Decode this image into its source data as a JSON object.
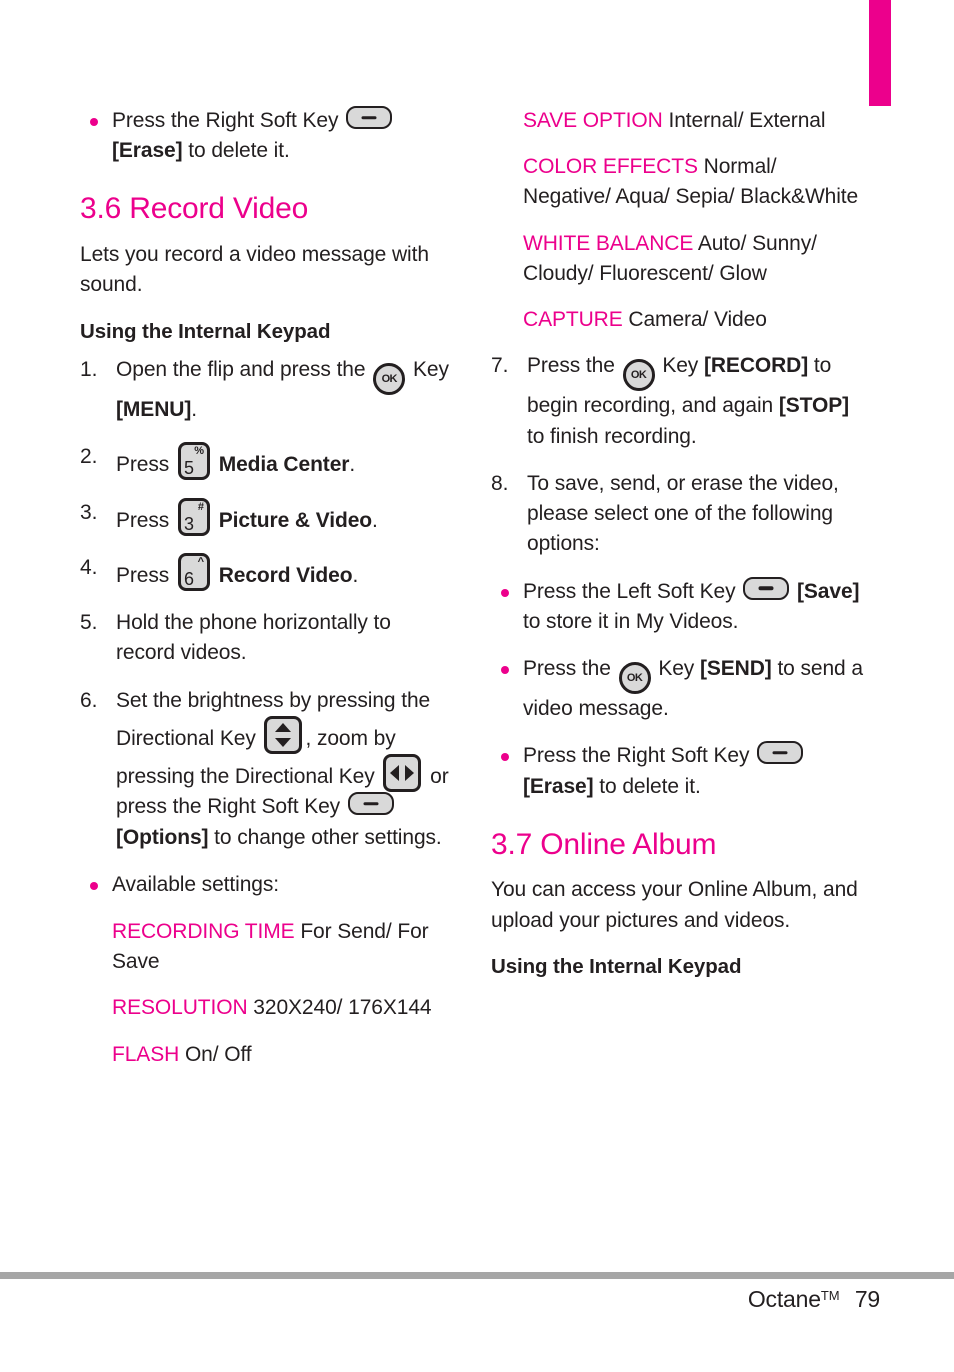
{
  "colors": {
    "accent": "#ec008c",
    "text": "#231f20",
    "key_fill": "#d9d9d9",
    "rule": "#a6a6a6"
  },
  "chapter_tab": {
    "label": ""
  },
  "left_column": {
    "top_bullet": {
      "lead": "Press the Right Soft Key",
      "icon": "soft-key-icon",
      "bold": "[Erase]",
      "tail": "to delete it."
    },
    "heading": "3.6 Record Video",
    "intro": "Lets you record a video message with sound.",
    "subheading": "Using the Internal Keypad",
    "steps": [
      {
        "num": "1.",
        "lead": "Open the flip and press the",
        "icon": "ok-key-icon",
        "mid": "Key",
        "bold": "[MENU]",
        "tail": "."
      },
      {
        "num": "2.",
        "lead": "Press",
        "icon": "num-key-5-icon",
        "key_digit": "5",
        "key_sup": "%",
        "bold": "Media Center",
        "tail": "."
      },
      {
        "num": "3.",
        "lead": "Press",
        "icon": "num-key-3-icon",
        "key_digit": "3",
        "key_sup": "#",
        "bold": "Picture & Video",
        "tail": "."
      },
      {
        "num": "4.",
        "lead": "Press",
        "icon": "num-key-6-icon",
        "key_digit": "6",
        "key_sup": "^",
        "bold": "Record Video",
        "tail": "."
      },
      {
        "num": "5.",
        "lead": "Hold the phone horizontally to record videos."
      },
      {
        "num": "6.",
        "part1": "Set the brightness by pressing the Directional Key",
        "icon1": "directional-key-vertical-icon",
        "part2": ", zoom by pressing the Directional Key",
        "icon2": "directional-key-horizontal-icon",
        "part3": "or press the Right Soft",
        "part4": "Key",
        "icon3": "soft-key-icon",
        "bold": "[Options]",
        "part5": "to change other settings."
      }
    ],
    "available_bullet": "Available settings:",
    "settings": [
      {
        "term": "RECORDING TIME",
        "value": "For Send/ For Save"
      },
      {
        "term": "RESOLUTION",
        "value": "320X240/ 176X144"
      },
      {
        "term": "FLASH",
        "value": "On/ Off"
      }
    ]
  },
  "right_column": {
    "settings": [
      {
        "term": "SAVE OPTION",
        "value": "Internal/ External"
      },
      {
        "term": "COLOR EFFECTS",
        "value": "Normal/ Negative/ Aqua/ Sepia/ Black&White"
      },
      {
        "term": "WHITE BALANCE",
        "value": "Auto/ Sunny/ Cloudy/ Fluorescent/ Glow"
      },
      {
        "term": "CAPTURE",
        "value": "Camera/ Video"
      }
    ],
    "steps": [
      {
        "num": "7.",
        "lead": "Press the",
        "icon": "ok-key-icon",
        "mid": "Key",
        "bold1": "[RECORD]",
        "mid2": "to begin recording, and again",
        "bold2": "[STOP]",
        "tail": "to finish recording."
      },
      {
        "num": "8.",
        "lead": "To save, send, or erase the video, please select one of the following options:"
      }
    ],
    "bullets": [
      {
        "lead": "Press the Left Soft Key",
        "icon": "soft-key-icon",
        "bold": "[Save]",
        "tail": "to store it in My Videos."
      },
      {
        "lead": "Press the",
        "icon": "ok-key-icon",
        "mid": "Key",
        "bold": "[SEND]",
        "tail": "to send a video message."
      },
      {
        "lead": "Press the Right Soft Key",
        "icon": "soft-key-icon",
        "bold": "[Erase]",
        "tail": "to delete it."
      }
    ],
    "heading": "3.7 Online Album",
    "intro": "You can access your Online Album, and upload your pictures and videos.",
    "subheading": "Using the Internal Keypad"
  },
  "footer": {
    "product": "Octane",
    "tm": "TM",
    "page_number": "79"
  }
}
